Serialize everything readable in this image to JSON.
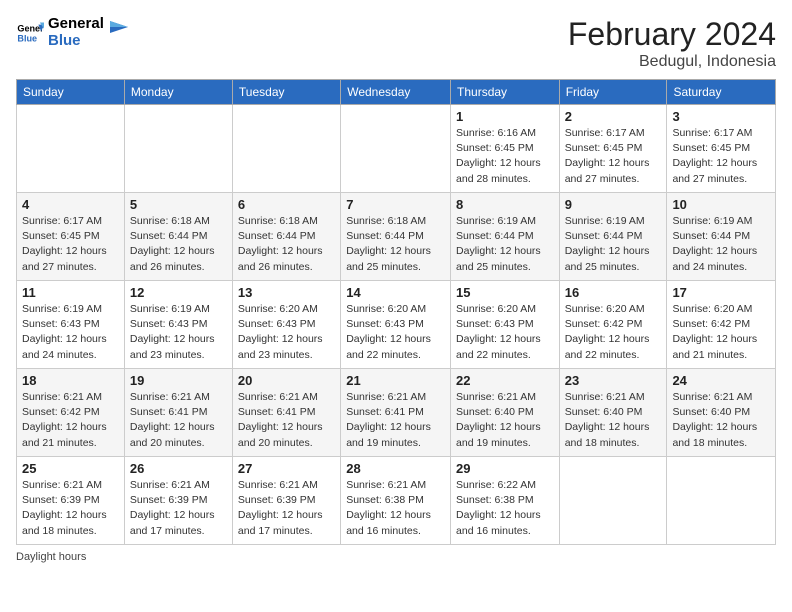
{
  "header": {
    "logo_line1": "General",
    "logo_line2": "Blue",
    "month_title": "February 2024",
    "location": "Bedugul, Indonesia"
  },
  "days_of_week": [
    "Sunday",
    "Monday",
    "Tuesday",
    "Wednesday",
    "Thursday",
    "Friday",
    "Saturday"
  ],
  "weeks": [
    [
      {
        "day": "",
        "sunrise": "",
        "sunset": "",
        "daylight": ""
      },
      {
        "day": "",
        "sunrise": "",
        "sunset": "",
        "daylight": ""
      },
      {
        "day": "",
        "sunrise": "",
        "sunset": "",
        "daylight": ""
      },
      {
        "day": "",
        "sunrise": "",
        "sunset": "",
        "daylight": ""
      },
      {
        "day": "1",
        "sunrise": "6:16 AM",
        "sunset": "6:45 PM",
        "daylight": "12 hours and 28 minutes."
      },
      {
        "day": "2",
        "sunrise": "6:17 AM",
        "sunset": "6:45 PM",
        "daylight": "12 hours and 27 minutes."
      },
      {
        "day": "3",
        "sunrise": "6:17 AM",
        "sunset": "6:45 PM",
        "daylight": "12 hours and 27 minutes."
      }
    ],
    [
      {
        "day": "4",
        "sunrise": "6:17 AM",
        "sunset": "6:45 PM",
        "daylight": "12 hours and 27 minutes."
      },
      {
        "day": "5",
        "sunrise": "6:18 AM",
        "sunset": "6:44 PM",
        "daylight": "12 hours and 26 minutes."
      },
      {
        "day": "6",
        "sunrise": "6:18 AM",
        "sunset": "6:44 PM",
        "daylight": "12 hours and 26 minutes."
      },
      {
        "day": "7",
        "sunrise": "6:18 AM",
        "sunset": "6:44 PM",
        "daylight": "12 hours and 25 minutes."
      },
      {
        "day": "8",
        "sunrise": "6:19 AM",
        "sunset": "6:44 PM",
        "daylight": "12 hours and 25 minutes."
      },
      {
        "day": "9",
        "sunrise": "6:19 AM",
        "sunset": "6:44 PM",
        "daylight": "12 hours and 25 minutes."
      },
      {
        "day": "10",
        "sunrise": "6:19 AM",
        "sunset": "6:44 PM",
        "daylight": "12 hours and 24 minutes."
      }
    ],
    [
      {
        "day": "11",
        "sunrise": "6:19 AM",
        "sunset": "6:43 PM",
        "daylight": "12 hours and 24 minutes."
      },
      {
        "day": "12",
        "sunrise": "6:19 AM",
        "sunset": "6:43 PM",
        "daylight": "12 hours and 23 minutes."
      },
      {
        "day": "13",
        "sunrise": "6:20 AM",
        "sunset": "6:43 PM",
        "daylight": "12 hours and 23 minutes."
      },
      {
        "day": "14",
        "sunrise": "6:20 AM",
        "sunset": "6:43 PM",
        "daylight": "12 hours and 22 minutes."
      },
      {
        "day": "15",
        "sunrise": "6:20 AM",
        "sunset": "6:43 PM",
        "daylight": "12 hours and 22 minutes."
      },
      {
        "day": "16",
        "sunrise": "6:20 AM",
        "sunset": "6:42 PM",
        "daylight": "12 hours and 22 minutes."
      },
      {
        "day": "17",
        "sunrise": "6:20 AM",
        "sunset": "6:42 PM",
        "daylight": "12 hours and 21 minutes."
      }
    ],
    [
      {
        "day": "18",
        "sunrise": "6:21 AM",
        "sunset": "6:42 PM",
        "daylight": "12 hours and 21 minutes."
      },
      {
        "day": "19",
        "sunrise": "6:21 AM",
        "sunset": "6:41 PM",
        "daylight": "12 hours and 20 minutes."
      },
      {
        "day": "20",
        "sunrise": "6:21 AM",
        "sunset": "6:41 PM",
        "daylight": "12 hours and 20 minutes."
      },
      {
        "day": "21",
        "sunrise": "6:21 AM",
        "sunset": "6:41 PM",
        "daylight": "12 hours and 19 minutes."
      },
      {
        "day": "22",
        "sunrise": "6:21 AM",
        "sunset": "6:40 PM",
        "daylight": "12 hours and 19 minutes."
      },
      {
        "day": "23",
        "sunrise": "6:21 AM",
        "sunset": "6:40 PM",
        "daylight": "12 hours and 18 minutes."
      },
      {
        "day": "24",
        "sunrise": "6:21 AM",
        "sunset": "6:40 PM",
        "daylight": "12 hours and 18 minutes."
      }
    ],
    [
      {
        "day": "25",
        "sunrise": "6:21 AM",
        "sunset": "6:39 PM",
        "daylight": "12 hours and 18 minutes."
      },
      {
        "day": "26",
        "sunrise": "6:21 AM",
        "sunset": "6:39 PM",
        "daylight": "12 hours and 17 minutes."
      },
      {
        "day": "27",
        "sunrise": "6:21 AM",
        "sunset": "6:39 PM",
        "daylight": "12 hours and 17 minutes."
      },
      {
        "day": "28",
        "sunrise": "6:21 AM",
        "sunset": "6:38 PM",
        "daylight": "12 hours and 16 minutes."
      },
      {
        "day": "29",
        "sunrise": "6:22 AM",
        "sunset": "6:38 PM",
        "daylight": "12 hours and 16 minutes."
      },
      {
        "day": "",
        "sunrise": "",
        "sunset": "",
        "daylight": ""
      },
      {
        "day": "",
        "sunrise": "",
        "sunset": "",
        "daylight": ""
      }
    ]
  ],
  "footer": {
    "daylight_label": "Daylight hours"
  }
}
